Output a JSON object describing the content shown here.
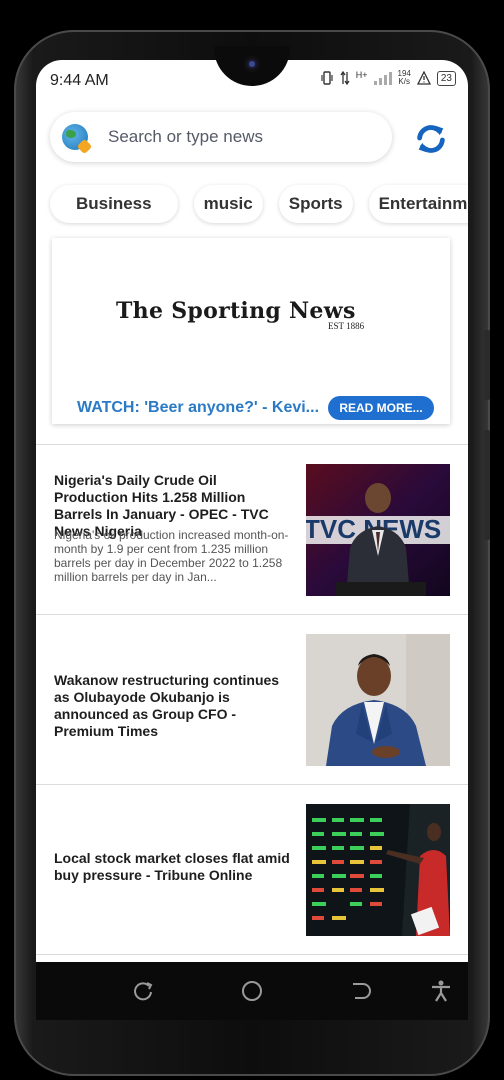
{
  "status_bar": {
    "time": "9:44 AM",
    "network_type": "H+",
    "speed_value": "194",
    "speed_unit": "K/s",
    "battery": "23"
  },
  "search": {
    "placeholder": "Search or type news"
  },
  "categories": [
    "Business",
    "music",
    "Sports",
    "Entertainme"
  ],
  "banner": {
    "logo_text": "The Sporting News",
    "logo_est": "EST 1886",
    "headline": "WATCH: 'Beer anyone?' - Kevi...",
    "button_label": "READ MORE..."
  },
  "articles": [
    {
      "title": "Nigeria's Daily Crude Oil Production Hits 1.258 Million Barrels In January - OPEC - TVC News Nigeria",
      "description": "Nigeria's oil production increased month-on-month by 1.9 per cent from 1.235 million barrels per day in December 2022 to 1.258 million barrels per day in Jan...",
      "thumb_text": "TVC NEWS"
    },
    {
      "title": "Wakanow restructuring continues as Olubayode Okubanjo is announced as Group CFO - Premium Times"
    },
    {
      "title": "Local stock market closes flat amid buy pressure - Tribune Online"
    }
  ],
  "colors": {
    "accent_blue": "#1f6fd0",
    "headline_blue": "#2b7ac6",
    "refresh_blue": "#1565c0"
  },
  "icons": {
    "search": "globe-icon",
    "refresh": "refresh-icon",
    "nav": [
      "recent-apps-icon",
      "home-icon",
      "back-icon",
      "accessibility-icon"
    ]
  }
}
